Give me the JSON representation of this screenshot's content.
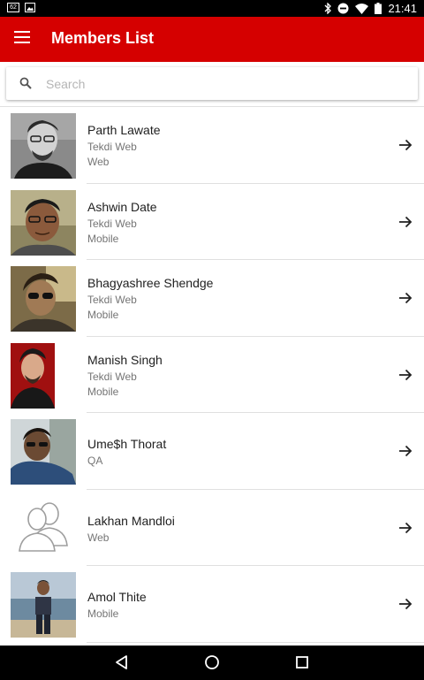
{
  "status_bar": {
    "left_icons": [
      "notification-icon",
      "image-icon"
    ],
    "right_icons": [
      "bluetooth-icon",
      "do-not-disturb-icon",
      "wifi-icon",
      "battery-icon"
    ],
    "time": "21:41"
  },
  "app_bar": {
    "title": "Members List",
    "menu_icon": "hamburger-menu-icon",
    "color": "#d50000"
  },
  "search": {
    "placeholder": "Search",
    "value": ""
  },
  "members": [
    {
      "name": "Parth Lawate",
      "lines": [
        "Tekdi Web",
        "Web"
      ],
      "avatar": "photo"
    },
    {
      "name": "Ashwin Date",
      "lines": [
        "Tekdi Web",
        "Mobile"
      ],
      "avatar": "photo"
    },
    {
      "name": "Bhagyashree Shendge",
      "lines": [
        "Tekdi Web",
        "Mobile"
      ],
      "avatar": "photo"
    },
    {
      "name": "Manish Singh",
      "lines": [
        "Tekdi Web",
        "Mobile"
      ],
      "avatar": "photo"
    },
    {
      "name": "Ume$h Thorat",
      "lines": [
        "QA"
      ],
      "avatar": "photo"
    },
    {
      "name": "Lakhan Mandloi",
      "lines": [
        "Web"
      ],
      "avatar": "placeholder-person-icon"
    },
    {
      "name": "Amol Thite",
      "lines": [
        "Mobile"
      ],
      "avatar": "photo"
    }
  ],
  "nav_bar": {
    "icons": [
      "back-icon",
      "home-icon",
      "recents-icon"
    ]
  }
}
